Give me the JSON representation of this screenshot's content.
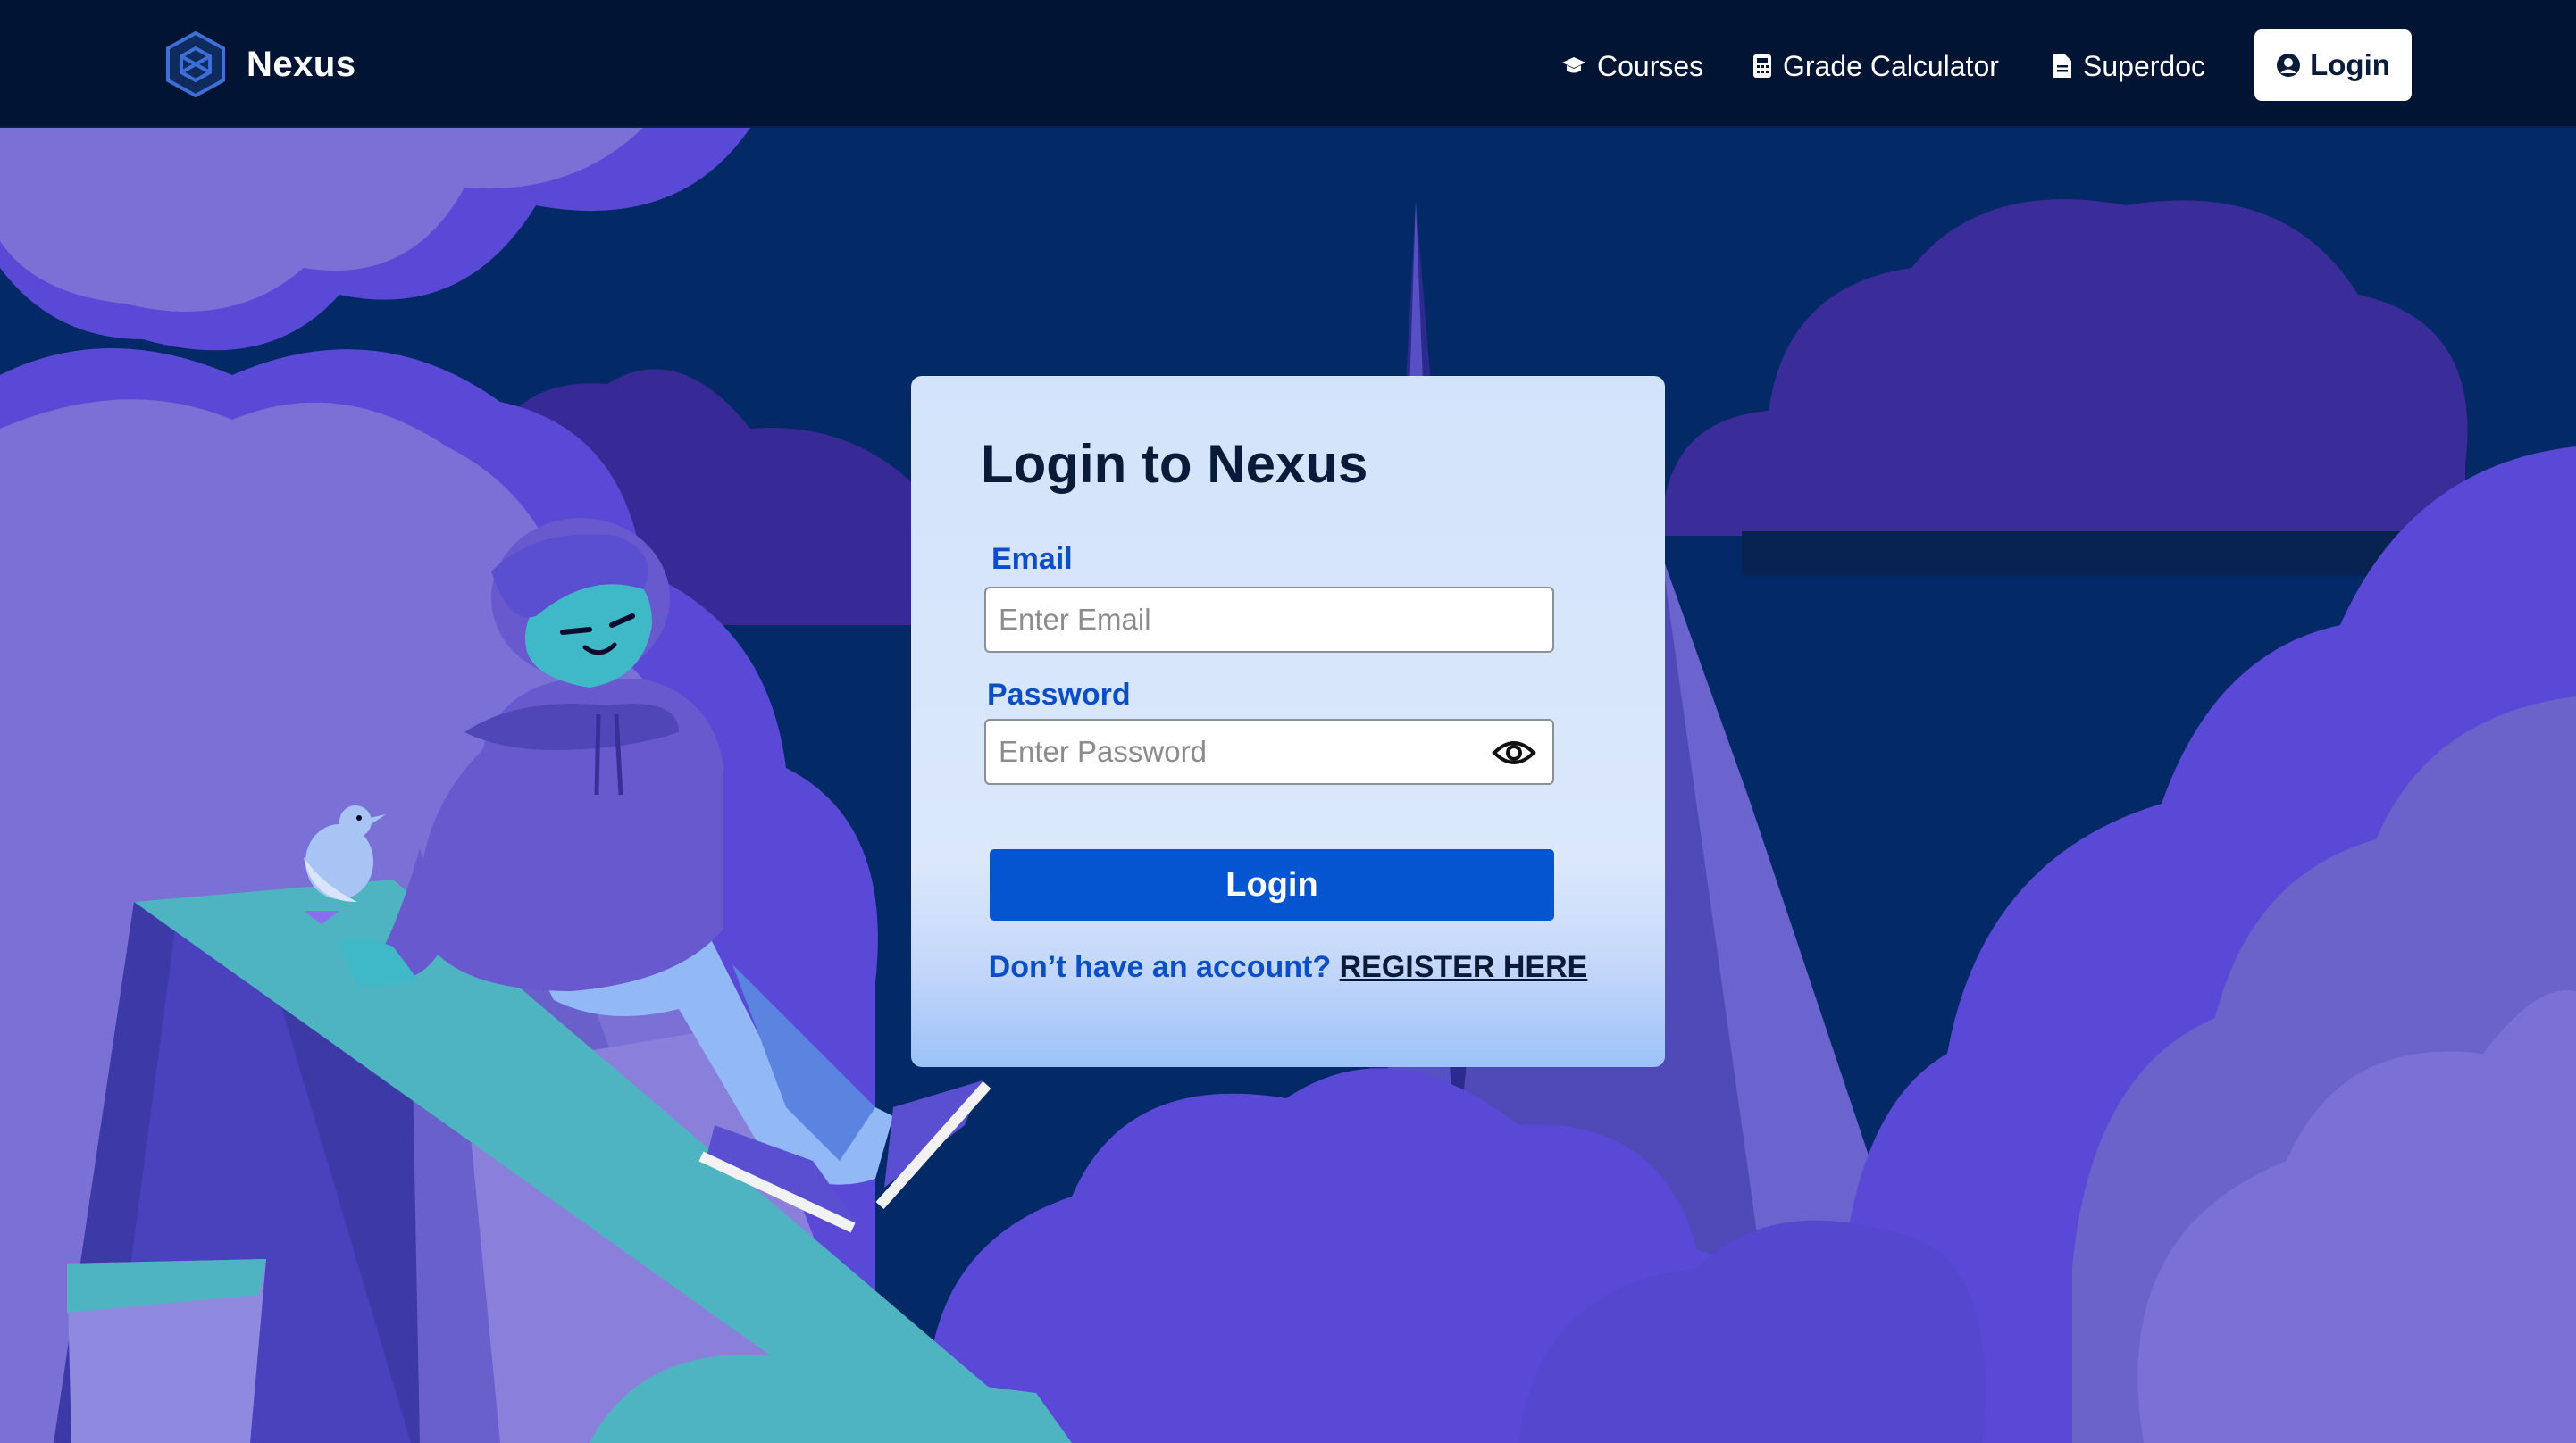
{
  "navbar": {
    "brand": "Nexus",
    "links": [
      {
        "label": "Courses",
        "icon": "graduation-cap-icon"
      },
      {
        "label": "Grade Calculator",
        "icon": "calculator-icon"
      },
      {
        "label": "Superdoc",
        "icon": "document-icon"
      }
    ],
    "login_label": "Login",
    "login_icon": "user-circle-icon"
  },
  "login_form": {
    "title": "Login to Nexus",
    "email_label": "Email",
    "email_placeholder": "Enter Email",
    "password_label": "Password",
    "password_placeholder": "Enter Password",
    "password_toggle_icon": "eye-icon",
    "submit_label": "Login",
    "register_prompt": "Don’t have an account?",
    "register_link": "REGISTER HERE"
  },
  "colors": {
    "navbar": "#021434",
    "sky": "#032a66",
    "primary_button": "#0455cf",
    "label_blue": "#0c4fc4",
    "cloud": "#5a49d6"
  }
}
